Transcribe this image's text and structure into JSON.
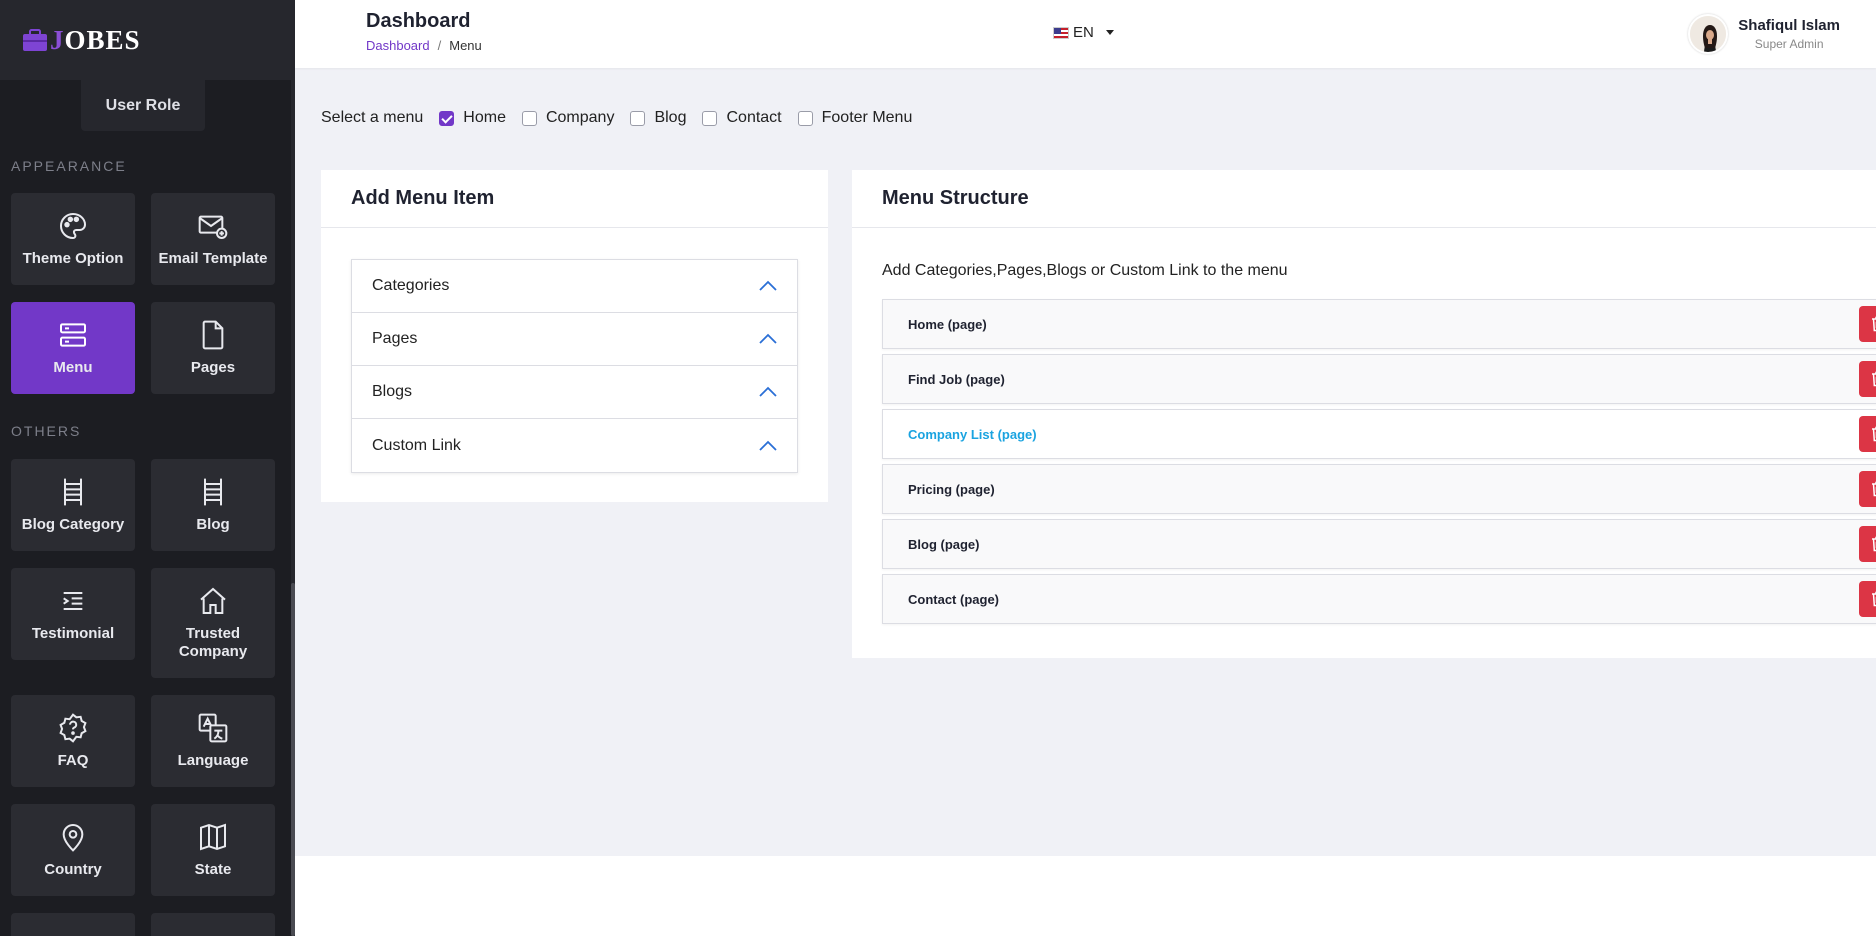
{
  "brand": {
    "logo_first": "J",
    "logo_rest": "OBES"
  },
  "sidebar": {
    "role_tile": "User Role",
    "appearance_label": "APPEARANCE",
    "others_label": "OTHERS",
    "appearance_items": [
      {
        "label": "Theme Option",
        "icon": "palette-icon"
      },
      {
        "label": "Email Template",
        "icon": "mail-plus-icon"
      },
      {
        "label": "Menu",
        "icon": "menu-icon",
        "active": true
      },
      {
        "label": "Pages",
        "icon": "file-icon"
      }
    ],
    "other_items": [
      {
        "label": "Blog Category",
        "icon": "ladder-icon"
      },
      {
        "label": "Blog",
        "icon": "ladder-icon"
      },
      {
        "label": "Testimonial",
        "icon": "quote-list-icon"
      },
      {
        "label_line1": "Trusted",
        "label_line2": "Company",
        "icon": "home-icon"
      },
      {
        "label": "FAQ",
        "icon": "help-badge-icon"
      },
      {
        "label": "Language",
        "icon": "translate-icon"
      },
      {
        "label": "Country",
        "icon": "map-pin-icon"
      },
      {
        "label": "State",
        "icon": "map-icon"
      }
    ],
    "accent_color": "#7238c8"
  },
  "header": {
    "title": "Dashboard",
    "breadcrumb": {
      "home": "Dashboard",
      "separator": "/",
      "current": "Menu"
    },
    "language": "EN",
    "user": {
      "name": "Shafiqul Islam",
      "role": "Super Admin"
    }
  },
  "menu_select": {
    "label": "Select a menu",
    "options": [
      {
        "label": "Home",
        "checked": true
      },
      {
        "label": "Company",
        "checked": false
      },
      {
        "label": "Blog",
        "checked": false
      },
      {
        "label": "Contact",
        "checked": false
      },
      {
        "label": "Footer Menu",
        "checked": false
      }
    ]
  },
  "add_menu": {
    "title": "Add Menu Item",
    "sections": [
      "Categories",
      "Pages",
      "Blogs",
      "Custom Link"
    ]
  },
  "menu_structure": {
    "title": "Menu Structure",
    "help_text": "Add Categories,Pages,Blogs or Custom Link to the menu",
    "items": [
      {
        "label": "Home (page)"
      },
      {
        "label": "Find Job (page)"
      },
      {
        "label": "Company List (page)",
        "highlighted": true
      },
      {
        "label": "Pricing (page)"
      },
      {
        "label": "Blog (page)"
      },
      {
        "label": "Contact (page)"
      }
    ],
    "delete_color": "#dc3545",
    "highlight_color": "#1aa3e0"
  }
}
